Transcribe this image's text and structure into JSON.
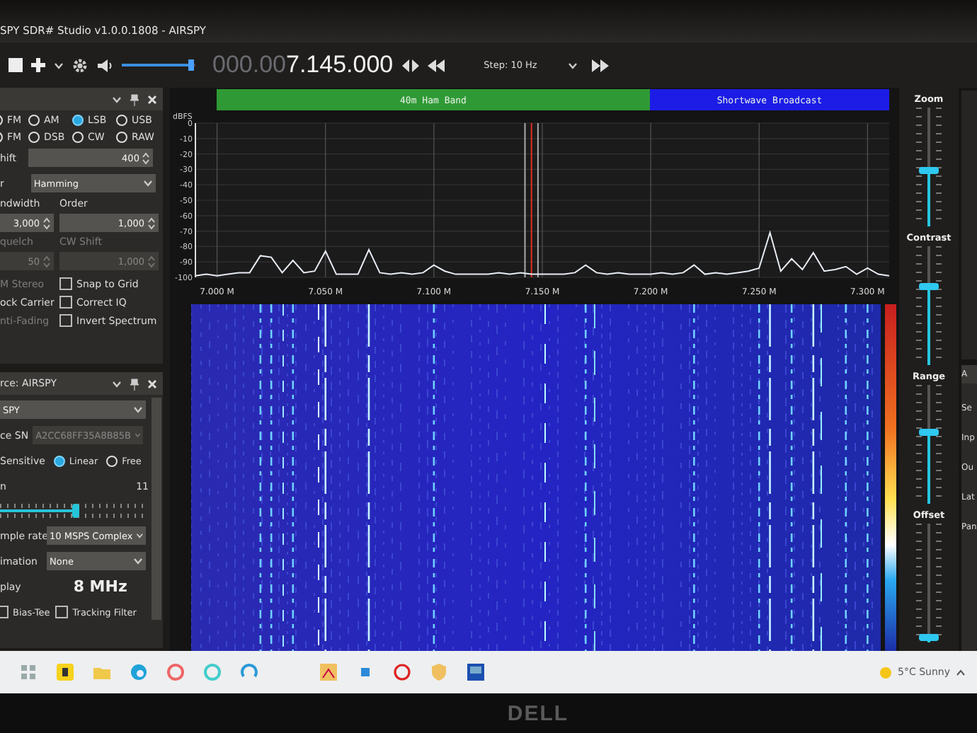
{
  "window": {
    "title": "SPY SDR# Studio v1.0.0.1808 - AIRSPY"
  },
  "toolbar": {
    "volume": {
      "level": 0.95
    },
    "frequency_hidden_digits": "000.00",
    "frequency": "7.145.000",
    "step": "Step: 10 Hz"
  },
  "radio_panel": {
    "modes": [
      {
        "label": "FM",
        "selected": false
      },
      {
        "label": "AM",
        "selected": false
      },
      {
        "label": "LSB",
        "selected": true
      },
      {
        "label": "USB",
        "selected": false
      },
      {
        "label": "FM",
        "selected": false
      },
      {
        "label": "DSB",
        "selected": false
      },
      {
        "label": "CW",
        "selected": false
      },
      {
        "label": "RAW",
        "selected": false
      }
    ],
    "shift": {
      "label": "hift",
      "value": "400"
    },
    "filter": {
      "label": "r",
      "value": "Hamming"
    },
    "bandwidth": {
      "label": "ndwidth",
      "value": "3,000"
    },
    "order": {
      "label": "Order",
      "value": "1,000"
    },
    "squelch": {
      "label": "quelch",
      "value": "50",
      "disabled": true
    },
    "cw_shift": {
      "label": "CW Shift",
      "value": "1,000",
      "disabled": true
    },
    "options": [
      {
        "kind": "cut",
        "label": "M Stereo",
        "disabled": true
      },
      {
        "kind": "checkbox",
        "label": "Snap to Grid",
        "checked": false
      },
      {
        "kind": "cut",
        "label": "ock Carrier",
        "disabled": false
      },
      {
        "kind": "checkbox",
        "label": "Correct IQ",
        "checked": false
      },
      {
        "kind": "cut",
        "label": "nti-Fading",
        "disabled": true
      },
      {
        "kind": "checkbox",
        "label": "Invert Spectrum",
        "checked": false
      }
    ]
  },
  "source_panel": {
    "title": "rce: AIRSPY",
    "device": "SPY",
    "serial": {
      "label": "ce SN",
      "value": "A2CC68FF35A8B85B"
    },
    "sensitive_label": "Sensitive",
    "modes": [
      {
        "label": "Linear",
        "selected": true
      },
      {
        "label": "Free",
        "selected": false
      }
    ],
    "gain": {
      "label": "n",
      "value": "11",
      "level": 0.5
    },
    "sample_rate": {
      "label": "mple rate",
      "value": "10 MSPS Complex"
    },
    "decimation": {
      "label": "imation",
      "value": "None"
    },
    "display": {
      "label": "play",
      "value": "8 MHz"
    },
    "options": [
      {
        "label": "Bias-Tee",
        "checked": false
      },
      {
        "label": "Tracking Filter",
        "checked": false
      }
    ]
  },
  "spectrum": {
    "chart_data": {
      "type": "line",
      "ylabel": "dBFS",
      "x": [
        6.99,
        6.995,
        7.0,
        7.005,
        7.01,
        7.015,
        7.02,
        7.025,
        7.03,
        7.035,
        7.04,
        7.045,
        7.05,
        7.055,
        7.06,
        7.065,
        7.07,
        7.075,
        7.08,
        7.085,
        7.09,
        7.095,
        7.1,
        7.105,
        7.11,
        7.115,
        7.12,
        7.125,
        7.13,
        7.135,
        7.14,
        7.145,
        7.15,
        7.155,
        7.16,
        7.165,
        7.17,
        7.175,
        7.18,
        7.185,
        7.19,
        7.195,
        7.2,
        7.205,
        7.21,
        7.215,
        7.22,
        7.225,
        7.23,
        7.235,
        7.24,
        7.245,
        7.25,
        7.255,
        7.26,
        7.265,
        7.27,
        7.275,
        7.28,
        7.285,
        7.29,
        7.295,
        7.3,
        7.305,
        7.31
      ],
      "series": [
        {
          "color": "#e8ecf4",
          "values": [
            -99,
            -98,
            -99,
            -98,
            -97,
            -97,
            -86,
            -87,
            -97,
            -89,
            -97,
            -96,
            -83,
            -98,
            -98,
            -98,
            -82,
            -97,
            -98,
            -97,
            -98,
            -97,
            -92,
            -96,
            -98,
            -98,
            -98,
            -98,
            -97,
            -98,
            -97,
            -98,
            -98,
            -98,
            -98,
            -97,
            -92,
            -97,
            -98,
            -97,
            -98,
            -98,
            -98,
            -97,
            -98,
            -97,
            -92,
            -98,
            -97,
            -98,
            -97,
            -96,
            -94,
            -71,
            -96,
            -88,
            -95,
            -84,
            -96,
            -95,
            -93,
            -98,
            -94,
            -98,
            -99
          ]
        }
      ],
      "xlim": [
        6.99,
        7.31
      ],
      "ylim": [
        -100,
        0
      ],
      "xticks": [
        {
          "value": 7.0,
          "label": "7.000 M"
        },
        {
          "value": 7.05,
          "label": "7.050 M"
        },
        {
          "value": 7.1,
          "label": "7.100 M"
        },
        {
          "value": 7.15,
          "label": "7.150 M"
        },
        {
          "value": 7.2,
          "label": "7.200 M"
        },
        {
          "value": 7.25,
          "label": "7.250 M"
        },
        {
          "value": 7.3,
          "label": "7.300 M"
        }
      ],
      "yticks": [
        {
          "value": 0,
          "label": "0"
        },
        {
          "value": -10,
          "label": "-10"
        },
        {
          "value": -20,
          "label": "-20"
        },
        {
          "value": -30,
          "label": "-30"
        },
        {
          "value": -40,
          "label": "-40"
        },
        {
          "value": -50,
          "label": "-50"
        },
        {
          "value": -60,
          "label": "-60"
        },
        {
          "value": -70,
          "label": "-70"
        },
        {
          "value": -80,
          "label": "-80"
        },
        {
          "value": -90,
          "label": "-90"
        },
        {
          "value": -100,
          "label": "-100"
        }
      ],
      "grid": true,
      "ref_lines": [
        {
          "axis": "x",
          "value": 7.142,
          "color": "#aaaaaa"
        },
        {
          "axis": "x",
          "value": 7.145,
          "color": "#e03020"
        },
        {
          "axis": "x",
          "value": 7.148,
          "color": "#aaaaaa"
        }
      ]
    },
    "band_plan": [
      {
        "label": "40m Ham Band",
        "color": "#2f9a35"
      },
      {
        "label": "Shortwave Broadcast",
        "color": "#1c1ce6"
      }
    ]
  },
  "display_sliders": [
    {
      "label": "Zoom",
      "level": 0.46
    },
    {
      "label": "Contrast",
      "level": 0.66
    },
    {
      "label": "Range",
      "level": 0.6
    },
    {
      "label": "Offset",
      "level": 0.04
    }
  ],
  "audio_panel": {
    "title": "A",
    "labels": [
      "Se",
      "Inp",
      "Ou",
      "Lat",
      "Pan"
    ]
  },
  "taskbar": {
    "weather": "5°C Sunny"
  },
  "bezel": {
    "logo": "DELL"
  }
}
